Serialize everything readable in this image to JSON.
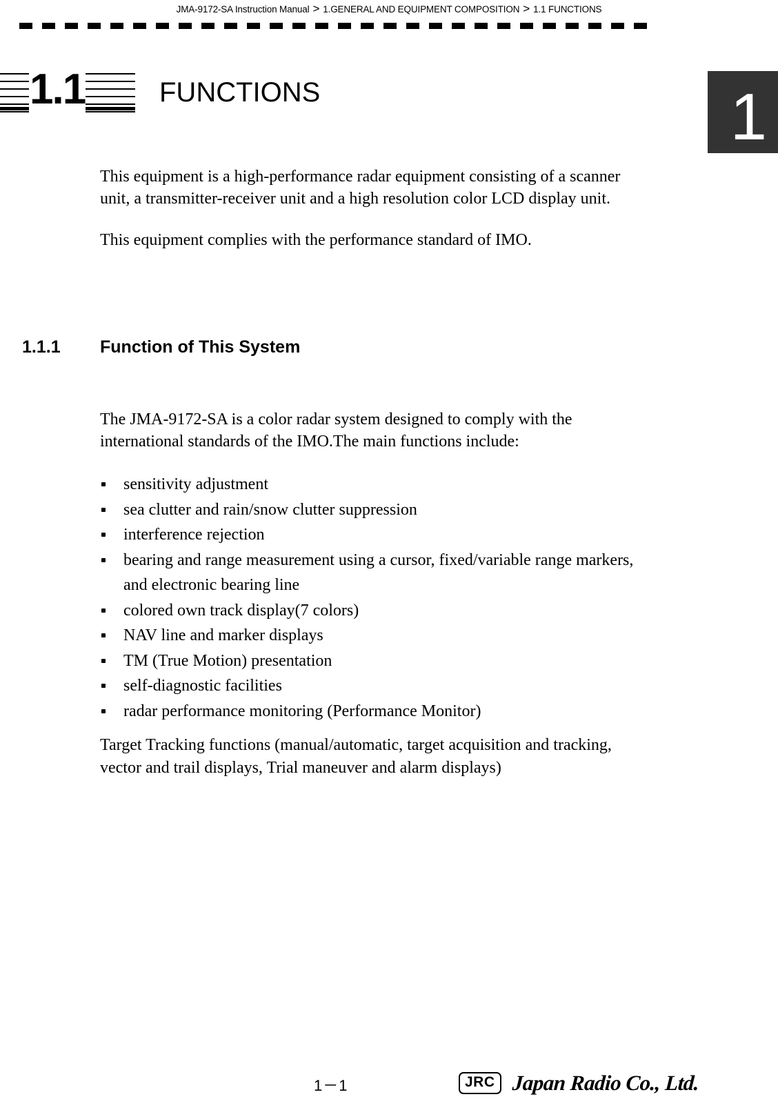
{
  "header": {
    "breadcrumb": [
      "JMA-9172-SA Instruction Manual",
      "1.GENERAL AND EQUIPMENT COMPOSITION",
      "1.1  FUNCTIONS"
    ],
    "separator": ">"
  },
  "chapter_tab": {
    "number": "1"
  },
  "section": {
    "number": "1.1",
    "title": "FUNCTIONS"
  },
  "intro": {
    "paragraph_1": "This equipment is a high-performance radar equipment consisting of a scanner unit, a transmitter-receiver unit and a high resolution color LCD display unit.",
    "paragraph_2": "This equipment complies with the performance standard of IMO."
  },
  "subsection": {
    "number": "1.1.1",
    "title": "Function of This System",
    "lead_paragraph": "The JMA-9172-SA is a color radar system designed to comply with the international standards of the IMO.The main functions include:",
    "bullets": [
      "sensitivity adjustment",
      "sea clutter and rain/snow clutter suppression",
      "interference rejection",
      "bearing and range measurement using a cursor, fixed/variable range markers, and electronic bearing line",
      "colored own track display(7 colors)",
      "NAV line and marker displays",
      "TM (True Motion) presentation",
      "self-diagnostic facilities",
      "radar performance monitoring (Performance Monitor)"
    ],
    "closing_note": "Target Tracking functions (manual/automatic, target acquisition and tracking, vector and trail displays, Trial maneuver and alarm displays)"
  },
  "footer": {
    "page_number": "1－1",
    "logo_mark": "JRC",
    "company_name": "Japan Radio Co., Ltd."
  },
  "colors": {
    "tab_background": "#333333",
    "tab_text": "#ffffff",
    "text": "#000000",
    "page_background": "#ffffff"
  }
}
